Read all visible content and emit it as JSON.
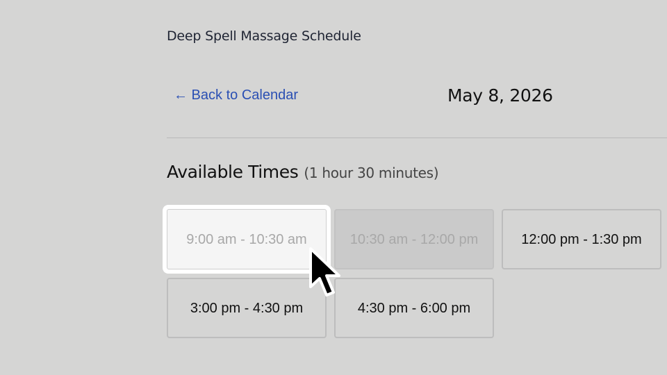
{
  "header": {
    "title": "Deep Spell Massage Schedule"
  },
  "nav": {
    "back_label": "← Back to Calendar"
  },
  "date": {
    "label": "May 8, 2026"
  },
  "availability": {
    "heading": "Available Times",
    "duration": "(1 hour 30 minutes)",
    "slots": [
      {
        "label": "9:00 am - 10:30 am",
        "state": "selected"
      },
      {
        "label": "10:30 am - 12:00 pm",
        "state": "unavailable"
      },
      {
        "label": "12:00 pm - 1:30 pm",
        "state": "available"
      },
      {
        "label": "3:00 pm - 4:30 pm",
        "state": "available"
      },
      {
        "label": "4:30 pm - 6:00 pm",
        "state": "available"
      }
    ]
  },
  "colors": {
    "background": "#d5d5d4",
    "link": "#2a4fb3",
    "selected_highlight": "#ffffff"
  },
  "icons": {
    "cursor": "mouse-pointer-icon"
  }
}
